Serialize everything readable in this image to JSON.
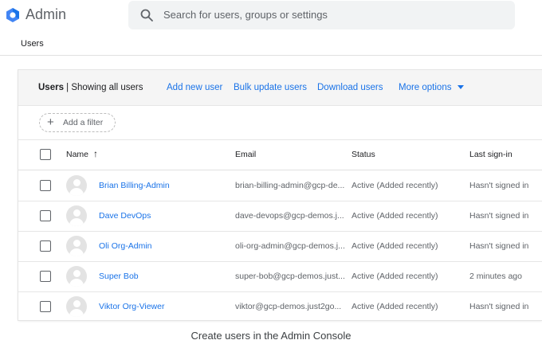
{
  "header": {
    "app_title": "Admin",
    "logo_icon": "admin-hexagon-logo-icon",
    "search_placeholder": "Search for users, groups or settings"
  },
  "breadcrumb": "Users",
  "toolbar": {
    "title_bold": "Users",
    "title_rest": " | Showing all users",
    "add_new_user": "Add new user",
    "bulk_update_users": "Bulk update users",
    "download_users": "Download users",
    "more_options": "More options"
  },
  "filter": {
    "label": "Add a filter"
  },
  "table": {
    "columns": {
      "name": "Name",
      "email": "Email",
      "status": "Status",
      "last_signin": "Last sign-in"
    },
    "sort_indicator": "↑",
    "rows": [
      {
        "name": "Brian Billing-Admin",
        "email": "brian-billing-admin@gcp-de...",
        "status": "Active (Added recently)",
        "last_signin": "Hasn't signed in"
      },
      {
        "name": "Dave DevOps",
        "email": "dave-devops@gcp-demos.j...",
        "status": "Active (Added recently)",
        "last_signin": "Hasn't signed in"
      },
      {
        "name": "Oli Org-Admin",
        "email": "oli-org-admin@gcp-demos.j...",
        "status": "Active (Added recently)",
        "last_signin": "Hasn't signed in"
      },
      {
        "name": "Super Bob",
        "email": "super-bob@gcp-demos.just...",
        "status": "Active (Added recently)",
        "last_signin": "2 minutes ago"
      },
      {
        "name": "Viktor Org-Viewer",
        "email": "viktor@gcp-demos.just2go...",
        "status": "Active (Added recently)",
        "last_signin": "Hasn't signed in"
      }
    ]
  },
  "caption": "Create users in the Admin Console",
  "colors": {
    "accent": "#1a73e8",
    "logo_blue": "#4285f4",
    "toolbar_bg": "#f5f5f5",
    "search_bg": "#f1f3f4"
  }
}
